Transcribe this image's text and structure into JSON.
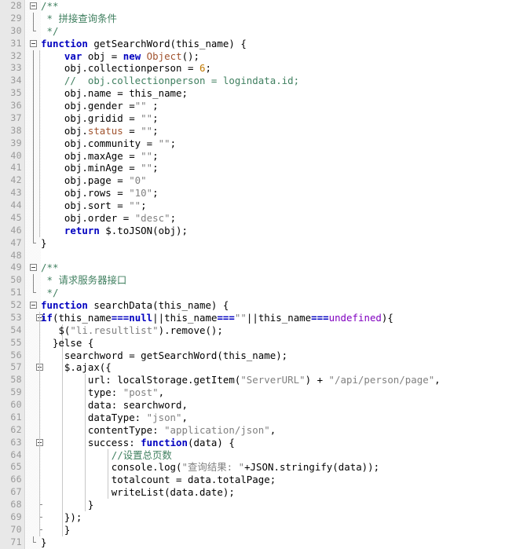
{
  "editor": {
    "name": "code-editor",
    "language": "JavaScript",
    "first_line": 28,
    "last_line": 71,
    "colors": {
      "background": "#ffffff",
      "gutter_background": "#e8e8e8",
      "line_number": "#999999",
      "keyword": "#0000c0",
      "comment": "#3f7f5f",
      "string": "#808080",
      "number": "#c07800",
      "field": "#a0522d",
      "undefined_literal": "#8000c0",
      "indent_guide": "#c8c8c8"
    }
  },
  "lines": [
    {
      "n": "28",
      "fold": "open",
      "depth": 0,
      "tokens": [
        {
          "t": "/**",
          "c": "cmtdoc"
        }
      ]
    },
    {
      "n": "29",
      "fold": "line",
      "depth": 0,
      "tokens": [
        {
          "t": " * 拼接查询条件",
          "c": "cmtdoc"
        }
      ]
    },
    {
      "n": "30",
      "fold": "end",
      "depth": 0,
      "tokens": [
        {
          "t": " */",
          "c": "cmtdoc"
        }
      ]
    },
    {
      "n": "31",
      "fold": "open",
      "depth": 0,
      "tokens": [
        {
          "t": "function",
          "c": "kw"
        },
        {
          "t": " getSearchWord(this_name) {",
          "c": "pl"
        }
      ]
    },
    {
      "n": "32",
      "fold": "line",
      "depth": 1,
      "tokens": [
        {
          "t": "    ",
          "c": "pl"
        },
        {
          "t": "var",
          "c": "kw"
        },
        {
          "t": " obj = ",
          "c": "pl"
        },
        {
          "t": "new",
          "c": "kw"
        },
        {
          "t": " ",
          "c": "pl"
        },
        {
          "t": "Object",
          "c": "fld"
        },
        {
          "t": "();",
          "c": "pl"
        }
      ]
    },
    {
      "n": "33",
      "fold": "line",
      "depth": 1,
      "tokens": [
        {
          "t": "    obj.collectionperson = ",
          "c": "pl"
        },
        {
          "t": "6",
          "c": "num"
        },
        {
          "t": ";",
          "c": "pl"
        }
      ]
    },
    {
      "n": "34",
      "fold": "line",
      "depth": 1,
      "tokens": [
        {
          "t": "    //  obj.collectionperson = logindata.id;",
          "c": "cmt"
        }
      ]
    },
    {
      "n": "35",
      "fold": "line",
      "depth": 1,
      "tokens": [
        {
          "t": "    obj.name = this_name;",
          "c": "pl"
        }
      ]
    },
    {
      "n": "36",
      "fold": "line",
      "depth": 1,
      "tokens": [
        {
          "t": "    obj.gender =",
          "c": "pl"
        },
        {
          "t": "\"\"",
          "c": "str"
        },
        {
          "t": " ;",
          "c": "pl"
        }
      ]
    },
    {
      "n": "37",
      "fold": "line",
      "depth": 1,
      "tokens": [
        {
          "t": "    obj.gridid = ",
          "c": "pl"
        },
        {
          "t": "\"\"",
          "c": "str"
        },
        {
          "t": ";",
          "c": "pl"
        }
      ]
    },
    {
      "n": "38",
      "fold": "line",
      "depth": 1,
      "tokens": [
        {
          "t": "    obj.",
          "c": "pl"
        },
        {
          "t": "status",
          "c": "fld"
        },
        {
          "t": " = ",
          "c": "pl"
        },
        {
          "t": "\"\"",
          "c": "str"
        },
        {
          "t": ";",
          "c": "pl"
        }
      ]
    },
    {
      "n": "39",
      "fold": "line",
      "depth": 1,
      "tokens": [
        {
          "t": "    obj.community = ",
          "c": "pl"
        },
        {
          "t": "\"\"",
          "c": "str"
        },
        {
          "t": ";",
          "c": "pl"
        }
      ]
    },
    {
      "n": "40",
      "fold": "line",
      "depth": 1,
      "tokens": [
        {
          "t": "    obj.maxAge = ",
          "c": "pl"
        },
        {
          "t": "\"\"",
          "c": "str"
        },
        {
          "t": ";",
          "c": "pl"
        }
      ]
    },
    {
      "n": "41",
      "fold": "line",
      "depth": 1,
      "tokens": [
        {
          "t": "    obj.minAge = ",
          "c": "pl"
        },
        {
          "t": "\"\"",
          "c": "str"
        },
        {
          "t": ";",
          "c": "pl"
        }
      ]
    },
    {
      "n": "42",
      "fold": "line",
      "depth": 1,
      "tokens": [
        {
          "t": "    obj.page = ",
          "c": "pl"
        },
        {
          "t": "\"0\"",
          "c": "str"
        }
      ]
    },
    {
      "n": "43",
      "fold": "line",
      "depth": 1,
      "tokens": [
        {
          "t": "    obj.rows = ",
          "c": "pl"
        },
        {
          "t": "\"10\"",
          "c": "str"
        },
        {
          "t": ";",
          "c": "pl"
        }
      ]
    },
    {
      "n": "44",
      "fold": "line",
      "depth": 1,
      "tokens": [
        {
          "t": "    obj.sort = ",
          "c": "pl"
        },
        {
          "t": "\"\"",
          "c": "str"
        },
        {
          "t": ";",
          "c": "pl"
        }
      ]
    },
    {
      "n": "45",
      "fold": "line",
      "depth": 1,
      "tokens": [
        {
          "t": "    obj.order = ",
          "c": "pl"
        },
        {
          "t": "\"desc\"",
          "c": "str"
        },
        {
          "t": ";",
          "c": "pl"
        }
      ]
    },
    {
      "n": "46",
      "fold": "line",
      "depth": 1,
      "tokens": [
        {
          "t": "    ",
          "c": "pl"
        },
        {
          "t": "return",
          "c": "kw"
        },
        {
          "t": " $.toJSON(obj);",
          "c": "pl"
        }
      ]
    },
    {
      "n": "47",
      "fold": "end",
      "depth": 0,
      "tokens": [
        {
          "t": "}",
          "c": "pl"
        }
      ]
    },
    {
      "n": "48",
      "fold": "none",
      "depth": 0,
      "tokens": []
    },
    {
      "n": "49",
      "fold": "open",
      "depth": 0,
      "tokens": [
        {
          "t": "/**",
          "c": "cmtdoc"
        }
      ]
    },
    {
      "n": "50",
      "fold": "line",
      "depth": 0,
      "tokens": [
        {
          "t": " * 请求服务器接口",
          "c": "cmtdoc"
        }
      ]
    },
    {
      "n": "51",
      "fold": "end",
      "depth": 0,
      "tokens": [
        {
          "t": " */",
          "c": "cmtdoc"
        }
      ]
    },
    {
      "n": "52",
      "fold": "open",
      "depth": 0,
      "tokens": [
        {
          "t": "function",
          "c": "kw"
        },
        {
          "t": " searchData(this_name) {",
          "c": "pl"
        }
      ]
    },
    {
      "n": "53",
      "fold": "open2",
      "depth": 1,
      "tokens": [
        {
          "t": "if",
          "c": "kw"
        },
        {
          "t": "(this_name",
          "c": "pl"
        },
        {
          "t": "===",
          "c": "kw"
        },
        {
          "t": "null",
          "c": "kw"
        },
        {
          "t": "||this_name",
          "c": "pl"
        },
        {
          "t": "===",
          "c": "kw"
        },
        {
          "t": "\"\"",
          "c": "str"
        },
        {
          "t": "||this_name",
          "c": "pl"
        },
        {
          "t": "===",
          "c": "kw"
        },
        {
          "t": "undefined",
          "c": "undef"
        },
        {
          "t": "){",
          "c": "pl"
        }
      ]
    },
    {
      "n": "54",
      "fold": "line2",
      "depth": 2,
      "tokens": [
        {
          "t": "   $(",
          "c": "pl"
        },
        {
          "t": "\"li.resultlist\"",
          "c": "str"
        },
        {
          "t": ").remove();",
          "c": "pl"
        }
      ]
    },
    {
      "n": "55",
      "fold": "line2",
      "depth": 2,
      "tokens": [
        {
          "t": "  }else {",
          "c": "pl"
        }
      ]
    },
    {
      "n": "56",
      "fold": "line2",
      "depth": 2,
      "tokens": [
        {
          "t": "    searchword = getSearchWord(this_name);",
          "c": "pl"
        }
      ]
    },
    {
      "n": "57",
      "fold": "open2",
      "depth": 2,
      "tokens": [
        {
          "t": "    $.ajax({",
          "c": "pl"
        }
      ]
    },
    {
      "n": "58",
      "fold": "line2",
      "depth": 3,
      "tokens": [
        {
          "t": "        url: localStorage.getItem(",
          "c": "pl"
        },
        {
          "t": "\"ServerURL\"",
          "c": "str"
        },
        {
          "t": ") + ",
          "c": "pl"
        },
        {
          "t": "\"/api/person/page\"",
          "c": "str"
        },
        {
          "t": ",",
          "c": "pl"
        }
      ]
    },
    {
      "n": "59",
      "fold": "line2",
      "depth": 3,
      "tokens": [
        {
          "t": "        type: ",
          "c": "pl"
        },
        {
          "t": "\"post\"",
          "c": "str"
        },
        {
          "t": ",",
          "c": "pl"
        }
      ]
    },
    {
      "n": "60",
      "fold": "line2",
      "depth": 3,
      "tokens": [
        {
          "t": "        data: searchword,",
          "c": "pl"
        }
      ]
    },
    {
      "n": "61",
      "fold": "line2",
      "depth": 3,
      "tokens": [
        {
          "t": "        dataType: ",
          "c": "pl"
        },
        {
          "t": "\"json\"",
          "c": "str"
        },
        {
          "t": ",",
          "c": "pl"
        }
      ]
    },
    {
      "n": "62",
      "fold": "line2",
      "depth": 3,
      "tokens": [
        {
          "t": "        contentType: ",
          "c": "pl"
        },
        {
          "t": "\"application/json\"",
          "c": "str"
        },
        {
          "t": ",",
          "c": "pl"
        }
      ]
    },
    {
      "n": "63",
      "fold": "open2",
      "depth": 3,
      "tokens": [
        {
          "t": "        success: ",
          "c": "pl"
        },
        {
          "t": "function",
          "c": "kw"
        },
        {
          "t": "(data) {",
          "c": "pl"
        }
      ]
    },
    {
      "n": "64",
      "fold": "line2",
      "depth": 4,
      "tokens": [
        {
          "t": "            //设置总页数",
          "c": "cmt"
        }
      ]
    },
    {
      "n": "65",
      "fold": "line2",
      "depth": 4,
      "tokens": [
        {
          "t": "            console.log(",
          "c": "pl"
        },
        {
          "t": "\"查询结果: \"",
          "c": "str"
        },
        {
          "t": "+JSON.stringify(data));",
          "c": "pl"
        }
      ]
    },
    {
      "n": "66",
      "fold": "line2",
      "depth": 4,
      "tokens": [
        {
          "t": "            totalcount = data.totalPage;",
          "c": "pl"
        }
      ]
    },
    {
      "n": "67",
      "fold": "line2",
      "depth": 4,
      "tokens": [
        {
          "t": "            writeList(data.date);",
          "c": "pl"
        }
      ]
    },
    {
      "n": "68",
      "fold": "end2",
      "depth": 3,
      "tokens": [
        {
          "t": "        }",
          "c": "pl"
        }
      ]
    },
    {
      "n": "69",
      "fold": "end2",
      "depth": 2,
      "tokens": [
        {
          "t": "    });",
          "c": "pl"
        }
      ]
    },
    {
      "n": "70",
      "fold": "end2",
      "depth": 2,
      "tokens": [
        {
          "t": "    }",
          "c": "pl"
        }
      ]
    },
    {
      "n": "71",
      "fold": "end",
      "depth": 0,
      "tokens": [
        {
          "t": "}",
          "c": "pl"
        }
      ]
    }
  ]
}
